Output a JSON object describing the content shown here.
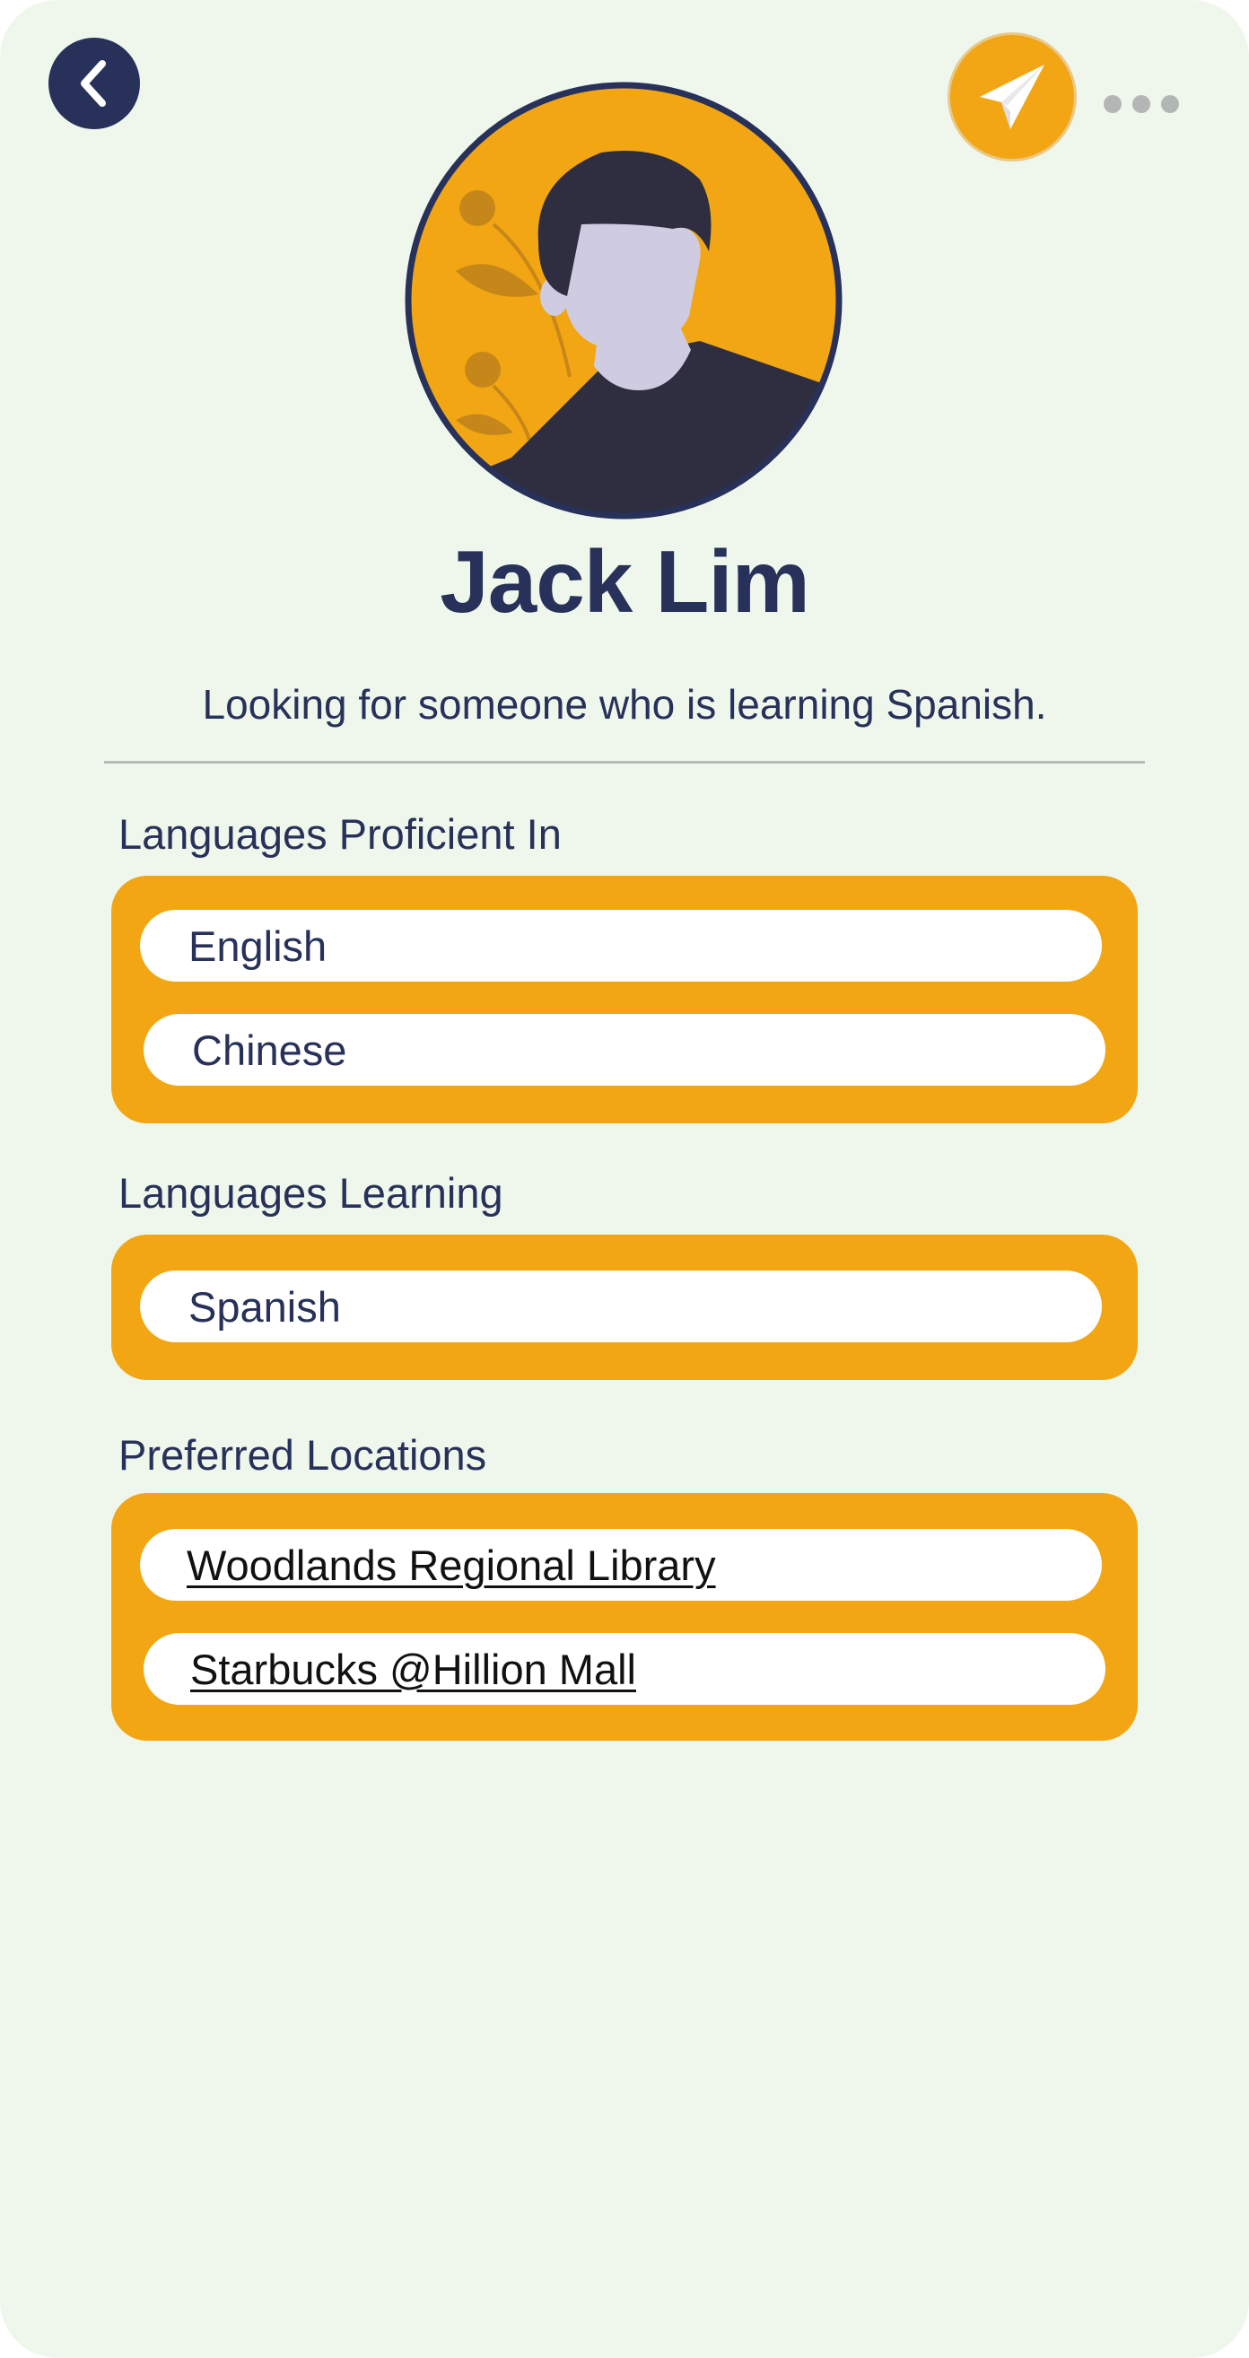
{
  "profile": {
    "name": "Jack Lim",
    "bio": "Looking for someone who is learning Spanish."
  },
  "header": {
    "back_icon": "chevron-left-icon",
    "send_icon": "paper-plane-icon",
    "more_icon": "more-horizontal-icon"
  },
  "sections": {
    "proficient": {
      "label": "Languages Proficient In",
      "items": [
        "English",
        "Chinese"
      ]
    },
    "learning": {
      "label": "Languages Learning",
      "items": [
        "Spanish"
      ]
    },
    "locations": {
      "label": "Preferred Locations",
      "items": [
        "Woodlands Regional Library",
        "Starbucks @Hillion Mall"
      ]
    }
  },
  "colors": {
    "background": "#eff7ec",
    "navy": "#273159",
    "accent": "#f3a613",
    "pill": "#ffffff"
  }
}
